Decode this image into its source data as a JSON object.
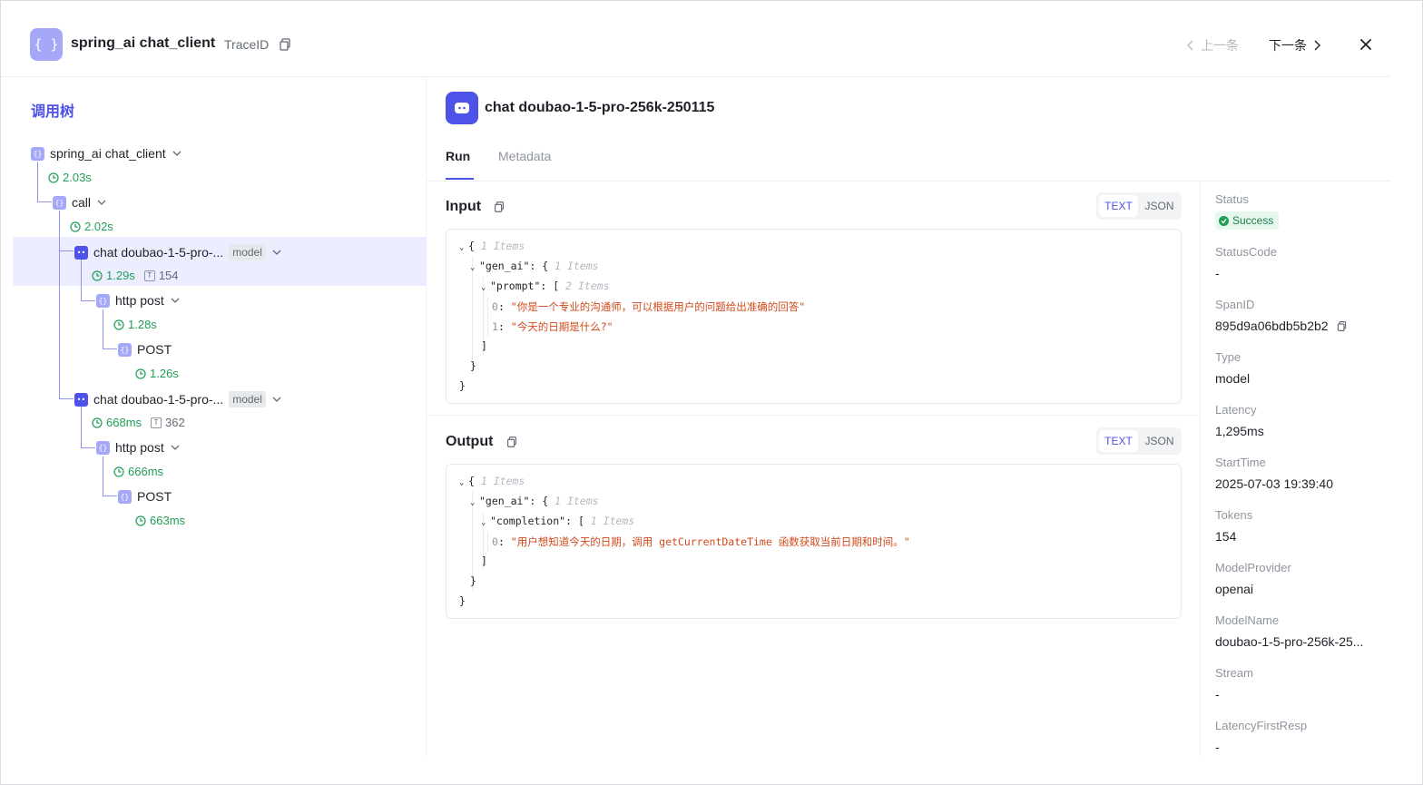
{
  "header": {
    "app_icon": "{ }",
    "title": "spring_ai chat_client",
    "trace_label": "TraceID",
    "prev_label": "上一条",
    "next_label": "下一条"
  },
  "tree": {
    "title": "调用树",
    "nodes": [
      {
        "label": "spring_ai chat_client",
        "time": "2.03s"
      },
      {
        "label": "call",
        "time": "2.02s"
      },
      {
        "label": "chat doubao-1-5-pro-...",
        "badge": "model",
        "time": "1.29s",
        "tokens": "154"
      },
      {
        "label": "http post",
        "time": "1.28s"
      },
      {
        "label": "POST",
        "time": "1.26s"
      },
      {
        "label": "chat doubao-1-5-pro-...",
        "badge": "model",
        "time": "668ms",
        "tokens": "362"
      },
      {
        "label": "http post",
        "time": "666ms"
      },
      {
        "label": "POST",
        "time": "663ms"
      }
    ],
    "token_icon": "T"
  },
  "main": {
    "title": "chat doubao-1-5-pro-256k-250115",
    "tabs": [
      "Run",
      "Metadata"
    ],
    "input": {
      "title": "Input",
      "toggle": [
        "TEXT",
        "JSON"
      ],
      "root_hint": "1 Items",
      "gen_ai_key": "\"gen_ai\"",
      "gen_ai_hint": "1 Items",
      "prompt_key": "\"prompt\"",
      "prompt_hint": "2 Items",
      "items": [
        "\"你是一个专业的沟通师，可以根据用户的问题给出准确的回答\"",
        "\"今天的日期是什么?\""
      ]
    },
    "output": {
      "title": "Output",
      "toggle": [
        "TEXT",
        "JSON"
      ],
      "root_hint": "1 Items",
      "gen_ai_key": "\"gen_ai\"",
      "gen_ai_hint": "1 Items",
      "completion_key": "\"completion\"",
      "completion_hint": "1 Items",
      "items": [
        "\"用户想知道今天的日期，调用 getCurrentDateTime 函数获取当前日期和时间。\""
      ]
    }
  },
  "info": {
    "status_label": "Status",
    "status_value": "Success",
    "statuscode_label": "StatusCode",
    "statuscode_value": "-",
    "spanid_label": "SpanID",
    "spanid_value": "895d9a06bdb5b2b2",
    "type_label": "Type",
    "type_value": "model",
    "latency_label": "Latency",
    "latency_value": "1,295ms",
    "starttime_label": "StartTime",
    "starttime_value": "2025-07-03 19:39:40",
    "tokens_label": "Tokens",
    "tokens_value": "154",
    "provider_label": "ModelProvider",
    "provider_value": "openai",
    "modelname_label": "ModelName",
    "modelname_value": "doubao-1-5-pro-256k-25...",
    "stream_label": "Stream",
    "stream_value": "-",
    "lfr_label": "LatencyFirstResp",
    "lfr_value": "-"
  },
  "colors": {
    "accent": "#4d53e8",
    "success": "#1f9d55",
    "string": "#d14a1b"
  }
}
